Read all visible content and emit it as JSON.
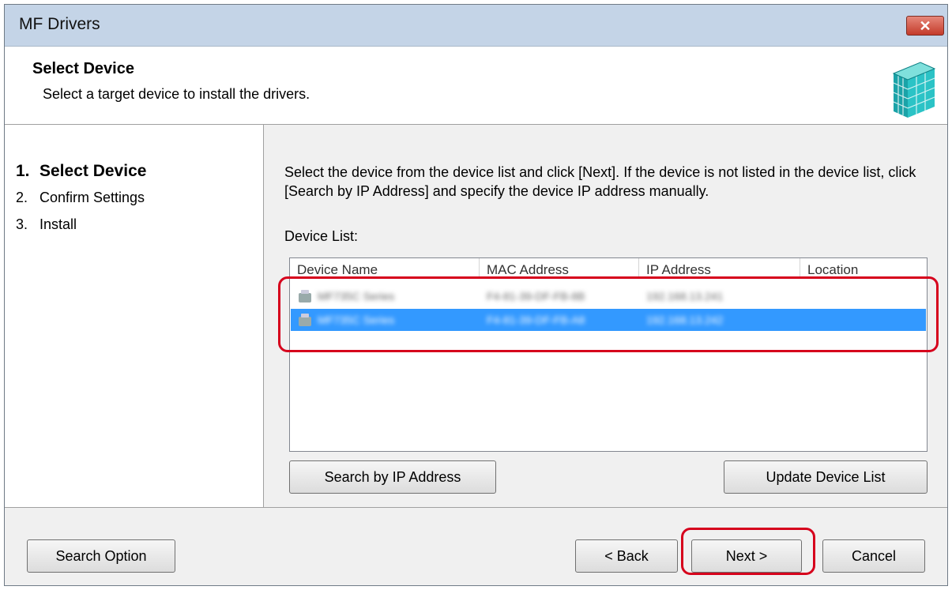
{
  "window": {
    "title": "MF Drivers",
    "close_label": "✕"
  },
  "header": {
    "title": "Select Device",
    "subtitle": "Select a target device to install the drivers."
  },
  "steps": [
    {
      "num": "1.",
      "label": "Select Device",
      "active": true
    },
    {
      "num": "2.",
      "label": "Confirm Settings",
      "active": false
    },
    {
      "num": "3.",
      "label": "Install",
      "active": false
    }
  ],
  "content": {
    "instruction": "Select the device from the device list and click [Next]. If the device is not listed in the device list, click [Search by IP Address] and specify the device IP address manually.",
    "list_label": "Device List:",
    "columns": [
      "Device Name",
      "MAC Address",
      "IP Address",
      "Location"
    ],
    "rows": [
      {
        "name": "MF735C Series",
        "mac": "F4-81-39-DF-FB-8B",
        "ip": "192.168.13.241",
        "location": "",
        "selected": false
      },
      {
        "name": "MF735C Series",
        "mac": "F4-81-39-DF-FB-A8",
        "ip": "192.168.13.242",
        "location": "",
        "selected": true
      }
    ],
    "search_ip_button": "Search by IP Address",
    "update_list_button": "Update Device List"
  },
  "footer": {
    "search_option_button": "Search Option",
    "back_button": "< Back",
    "next_button": "Next >",
    "cancel_button": "Cancel"
  },
  "colors": {
    "selection": "#3399ff",
    "highlight": "#d6001c",
    "titlebar": "#c4d4e7"
  },
  "icons": {
    "close": "close-icon",
    "header_graphic": "printer-device-icon",
    "row_device": "printer-icon"
  }
}
